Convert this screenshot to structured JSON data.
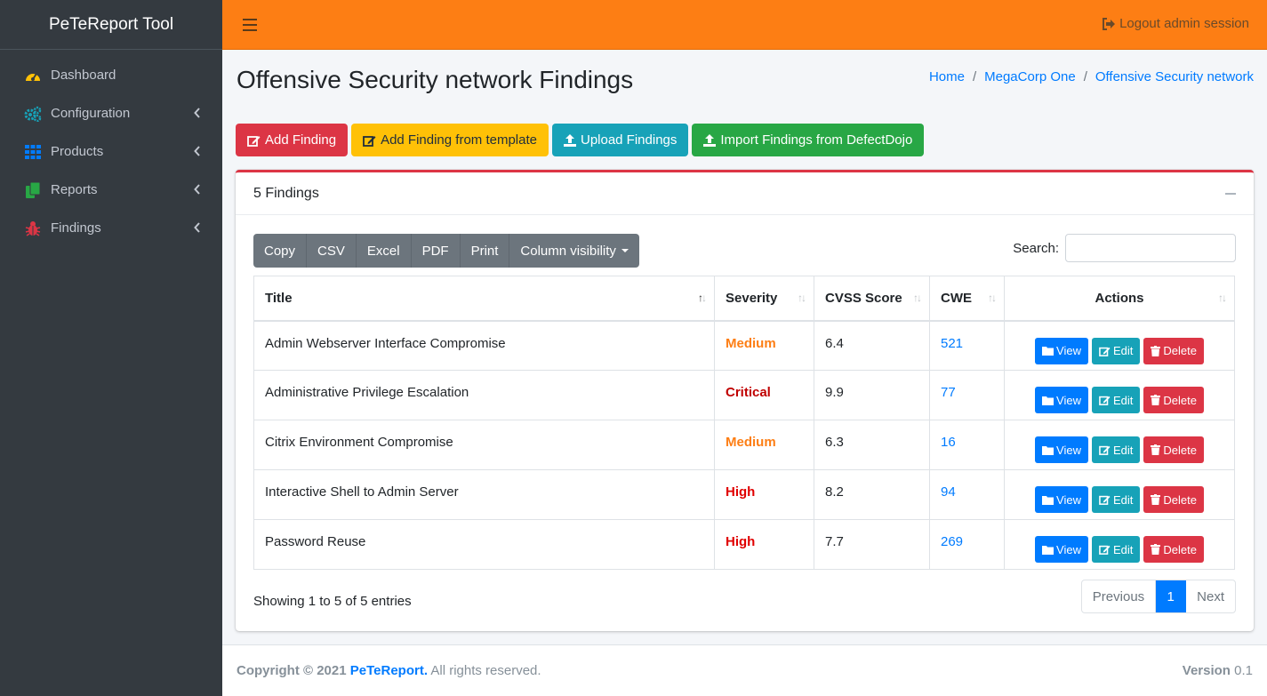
{
  "app": {
    "brand": "PeTeReport Tool"
  },
  "sidebar": {
    "items": [
      {
        "label": "Dashboard",
        "icon": "dashboard-gauge-icon",
        "color": "#ffc107",
        "has_chevron": false
      },
      {
        "label": "Configuration",
        "icon": "gears-icon",
        "color": "#17a2b8",
        "has_chevron": true
      },
      {
        "label": "Products",
        "icon": "grid-icon",
        "color": "#007bff",
        "has_chevron": true
      },
      {
        "label": "Reports",
        "icon": "copy-icon",
        "color": "#28a745",
        "has_chevron": true
      },
      {
        "label": "Findings",
        "icon": "bug-icon",
        "color": "#dc3545",
        "has_chevron": true
      }
    ]
  },
  "topbar": {
    "logout_label": "Logout admin session",
    "color": "#fd7e14"
  },
  "page": {
    "title": "Offensive Security network Findings"
  },
  "breadcrumb": [
    "Home",
    "MegaCorp One",
    "Offensive Security network"
  ],
  "actions": {
    "add_finding": "Add Finding",
    "add_from_template": "Add Finding from template",
    "upload": "Upload Findings",
    "import_defectdojo": "Import Findings from DefectDojo"
  },
  "card": {
    "title": "5 Findings"
  },
  "dt_buttons": {
    "copy": "Copy",
    "csv": "CSV",
    "excel": "Excel",
    "pdf": "PDF",
    "print": "Print",
    "column_visibility": "Column visibility"
  },
  "search": {
    "label": "Search:",
    "value": ""
  },
  "table": {
    "headers": {
      "title": "Title",
      "severity": "Severity",
      "cvss": "CVSS Score",
      "cwe": "CWE",
      "actions": "Actions"
    },
    "rows": [
      {
        "title": "Admin Webserver Interface Compromise",
        "severity": "Medium",
        "severity_color": "#fd7e14",
        "cvss": "6.4",
        "cwe": "521"
      },
      {
        "title": "Administrative Privilege Escalation",
        "severity": "Critical",
        "severity_color": "#c00000",
        "cvss": "9.9",
        "cwe": "77"
      },
      {
        "title": "Citrix Environment Compromise",
        "severity": "Medium",
        "severity_color": "#fd7e14",
        "cvss": "6.3",
        "cwe": "16"
      },
      {
        "title": "Interactive Shell to Admin Server",
        "severity": "High",
        "severity_color": "#e00000",
        "cvss": "8.2",
        "cwe": "94"
      },
      {
        "title": "Password Reuse",
        "severity": "High",
        "severity_color": "#e00000",
        "cvss": "7.7",
        "cwe": "269"
      }
    ],
    "row_actions": {
      "view": "View",
      "edit": "Edit",
      "delete": "Delete"
    }
  },
  "pagination": {
    "info": "Showing 1 to 5 of 5 entries",
    "previous": "Previous",
    "current": "1",
    "next": "Next"
  },
  "footer": {
    "copyright_prefix": "Copyright © 2021",
    "brand": "PeTeReport.",
    "rights": "All rights reserved.",
    "version_label": "Version",
    "version": "0.1"
  }
}
